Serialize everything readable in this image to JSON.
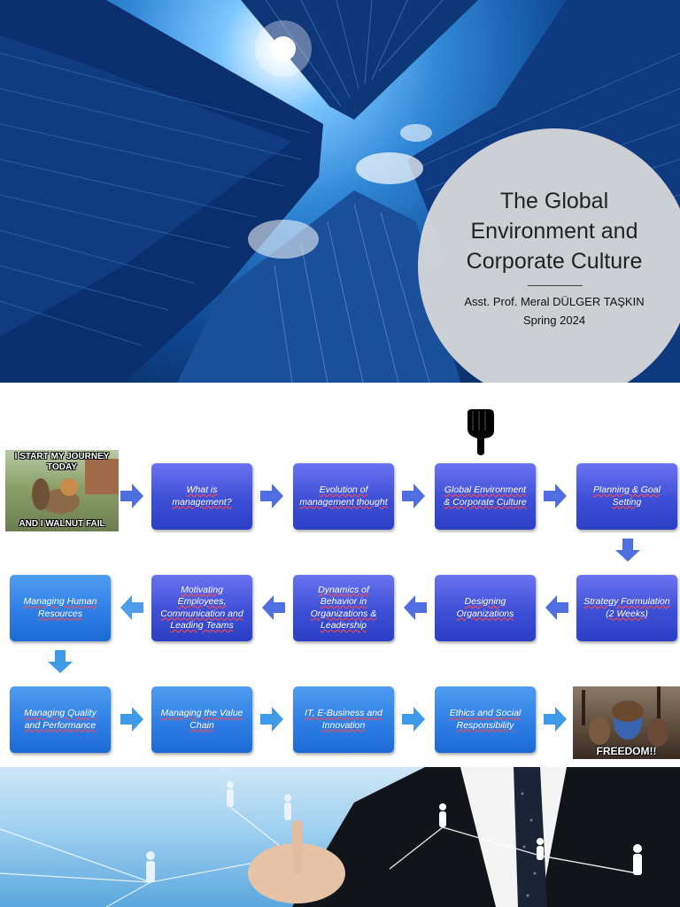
{
  "slide1": {
    "title_lines": [
      "The Global",
      "Environment and",
      "Corporate Culture"
    ],
    "author": "Asst. Prof. Meral DÜLGER TAŞKIN",
    "term": "Spring 2024"
  },
  "slide2": {
    "meme_start": {
      "top": "I START MY JOURNEY TODAY",
      "bottom": "AND I WALNUT FAIL"
    },
    "meme_end": {
      "bottom": "FREEDOM!!"
    },
    "pointer_icon": "pointing-hand-down",
    "row1": [
      "What is management?",
      "Evolution of management thought",
      "Global Environment & Corporate Culture",
      "Planning & Goal Setting"
    ],
    "row2": [
      "Strategy Formulation (2 Weeks)",
      "Designing Organizations",
      "Dynamics of Behavior in Organizations & Leadership",
      "Motivating Employees, Communication and Leading Teams",
      "Managing Human Resources"
    ],
    "row3": [
      "Managing Quality and Performance",
      "Managing the Value Chain",
      "IT, E-Business and Innovation",
      "Ethics and Social Responsibility"
    ],
    "colors": {
      "box": "#3d4fd6",
      "box_bright": "#2f7ee6",
      "arrow": "#4f6ee0",
      "arrow_bright": "#3f9ae8"
    }
  },
  "slide3": {
    "illustration": "businessman-network"
  }
}
